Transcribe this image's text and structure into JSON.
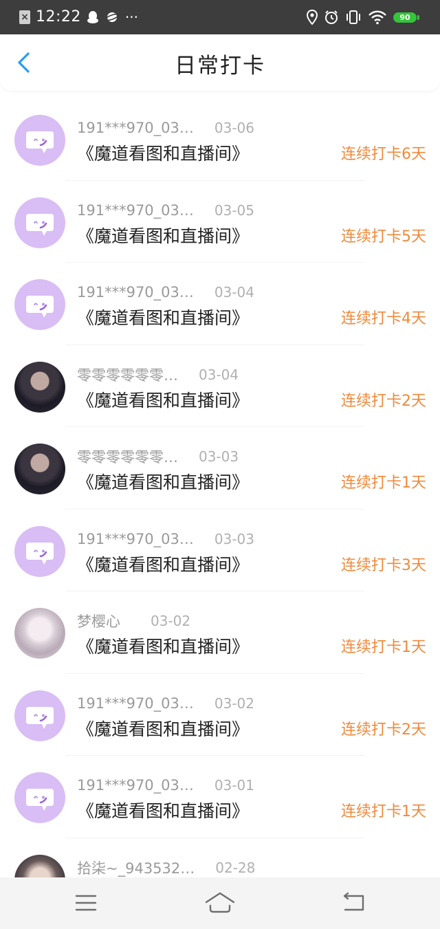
{
  "status_bar": {
    "time": "12:22",
    "more": "···",
    "battery": "90",
    "icons": [
      "close-notification-icon",
      "qq-penguin-icon",
      "planet-icon",
      "location-icon",
      "alarm-icon",
      "vibrate-icon",
      "wifi-icon",
      "battery-icon"
    ]
  },
  "nav": {
    "title": "日常打卡",
    "back_icon": "chevron-left-icon",
    "accent": "#2b9af3"
  },
  "colors": {
    "streak": "#ee8a3a",
    "default_avatar": "#d9bdf5"
  },
  "checkins": [
    {
      "user": "191***970_03…",
      "date": "03-06",
      "room": "《魔道看图和直播间》",
      "streak": "连续打卡6天"
    },
    {
      "user": "191***970_03…",
      "date": "03-05",
      "room": "《魔道看图和直播间》",
      "streak": "连续打卡5天"
    },
    {
      "user": "191***970_03…",
      "date": "03-04",
      "room": "《魔道看图和直播间》",
      "streak": "连续打卡4天"
    },
    {
      "user": "零零零零零零…",
      "date": "03-04",
      "room": "《魔道看图和直播间》",
      "streak": "连续打卡2天"
    },
    {
      "user": "零零零零零零…",
      "date": "03-03",
      "room": "《魔道看图和直播间》",
      "streak": "连续打卡1天"
    },
    {
      "user": "191***970_03…",
      "date": "03-03",
      "room": "《魔道看图和直播间》",
      "streak": "连续打卡3天"
    },
    {
      "user": "梦樱心",
      "date": "03-02",
      "room": "《魔道看图和直播间》",
      "streak": "连续打卡1天"
    },
    {
      "user": "191***970_03…",
      "date": "03-02",
      "room": "《魔道看图和直播间》",
      "streak": "连续打卡2天"
    },
    {
      "user": "191***970_03…",
      "date": "03-01",
      "room": "《魔道看图和直播间》",
      "streak": "连续打卡1天"
    },
    {
      "user": "拾柒~_943532…",
      "date": "02-28",
      "room": "",
      "streak": ""
    }
  ],
  "bottom_nav": {
    "icons": [
      "menu-icon",
      "home-icon",
      "back-icon"
    ]
  }
}
